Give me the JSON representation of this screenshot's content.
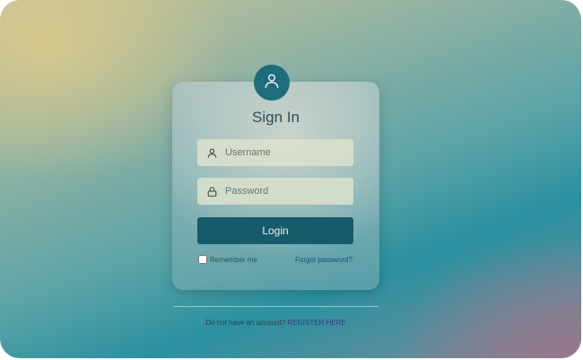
{
  "form": {
    "title": "Sign In",
    "username_placeholder": "Username",
    "password_placeholder": "Password",
    "login_label": "Login",
    "remember_label": "Remember me",
    "remember_checked": false,
    "forgot_label": "Forgot password?"
  },
  "footer": {
    "prompt": "Do not have an account?",
    "register_label": "REGISTER HERE"
  },
  "icons": {
    "avatar": "user-icon",
    "username": "user-outline-icon",
    "password": "lock-icon"
  },
  "colors": {
    "accent": "#165b6b",
    "avatar_bg": "#1f6c7b",
    "link": "#2b3d83"
  }
}
